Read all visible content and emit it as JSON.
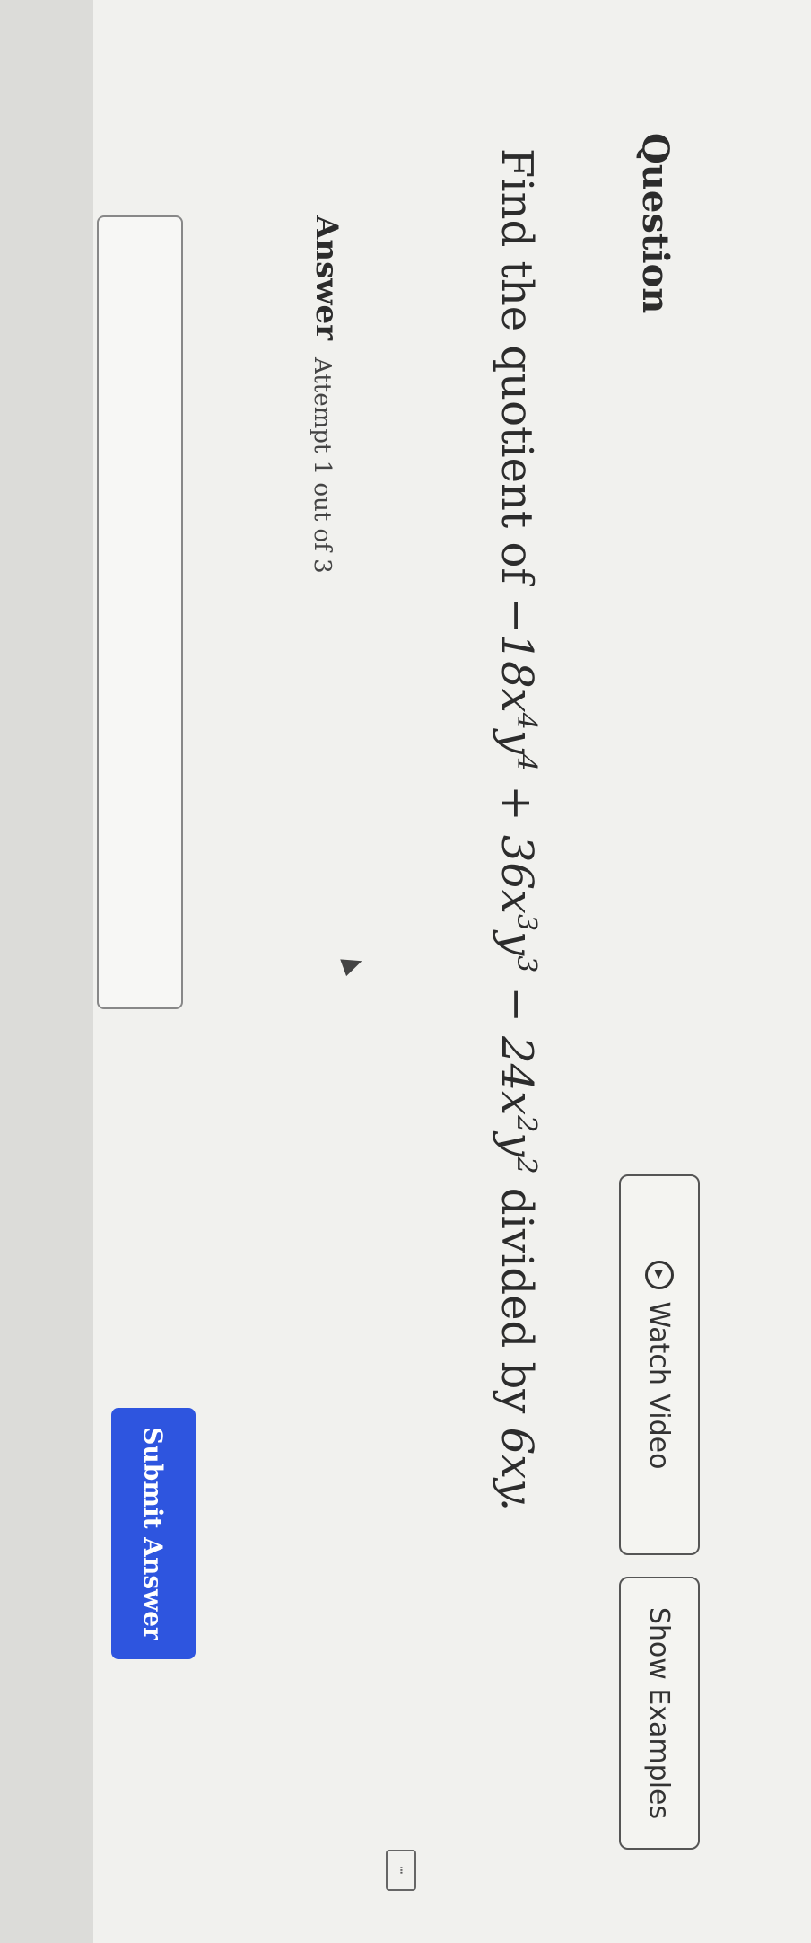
{
  "question": {
    "heading": "Question",
    "text_prefix": "Find the quotient of",
    "term1": "−18x",
    "exp1": "4",
    "var_y": "y",
    "exp2": "4",
    "op_plus": "+",
    "term2": "36x",
    "exp3": "3",
    "exp4": "3",
    "op_minus": "−",
    "term3": "24x",
    "exp5": "2",
    "exp6": "2",
    "text_suffix": "divided by",
    "divisor": "6xy."
  },
  "buttons": {
    "watch_video": "Watch Video",
    "show_examples": "Show Examples",
    "submit": "Submit Answer"
  },
  "answer": {
    "heading": "Answer",
    "attempt": "Attempt 1 out of 3",
    "value": ""
  },
  "icons": {
    "play": "play-circle-icon",
    "keyboard": "keyboard-icon",
    "cursor": "mouse-cursor-icon"
  },
  "colors": {
    "submit_bg": "#2e55df",
    "page_bg": "#f1f1ee"
  }
}
